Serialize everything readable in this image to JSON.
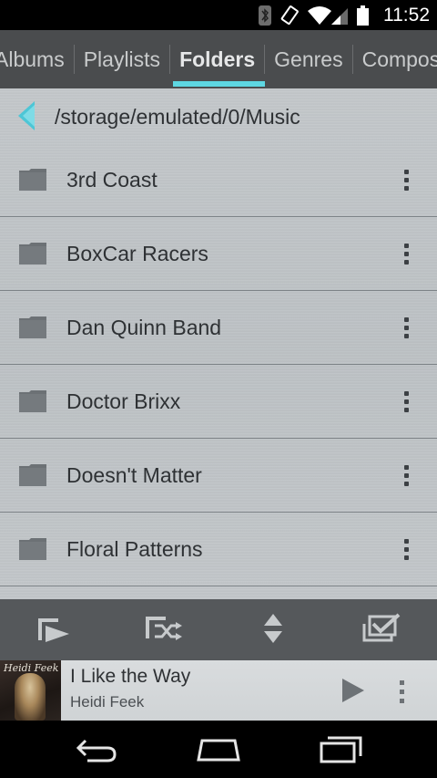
{
  "status_bar": {
    "time": "11:52",
    "icons": [
      "bluetooth-icon",
      "rotate-icon",
      "wifi-icon",
      "signal-icon",
      "battery-icon"
    ]
  },
  "tabs": [
    {
      "label": "Albums",
      "active": false
    },
    {
      "label": "Playlists",
      "active": false
    },
    {
      "label": "Folders",
      "active": true
    },
    {
      "label": "Genres",
      "active": false
    },
    {
      "label": "Composers",
      "active": false
    }
  ],
  "path": {
    "text": "/storage/emulated/0/Music"
  },
  "folders": [
    {
      "name": "3rd Coast"
    },
    {
      "name": "BoxCar Racers"
    },
    {
      "name": "Dan Quinn Band"
    },
    {
      "name": "Doctor Brixx"
    },
    {
      "name": "Doesn't Matter"
    },
    {
      "name": "Floral Patterns"
    }
  ],
  "actions": [
    "play-folder-icon",
    "shuffle-folder-icon",
    "sort-icon",
    "select-icon"
  ],
  "now_playing": {
    "title": "I Like the Way",
    "artist": "Heidi Feek",
    "cover_text": "Heidi Feek"
  },
  "colors": {
    "accent": "#5ed7e2",
    "tab_bar": "#4a4c4e",
    "action_bar": "#55585b"
  }
}
